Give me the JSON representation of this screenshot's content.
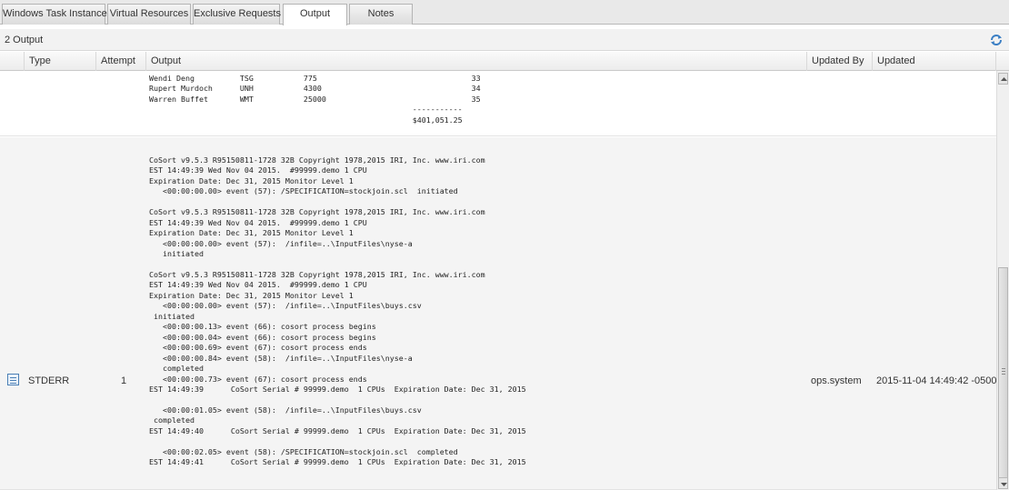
{
  "tabs": [
    {
      "label": "Windows Task Instance"
    },
    {
      "label": "Virtual Resources"
    },
    {
      "label": "Exclusive Requests"
    },
    {
      "label": "Output"
    },
    {
      "label": "Notes"
    }
  ],
  "panel": {
    "title": "2 Output"
  },
  "columns": {
    "type": "Type",
    "attempt": "Attempt",
    "output": "Output",
    "updated_by": "Updated By",
    "updated": "Updated"
  },
  "row1": {
    "output": "Wendi Deng          TSG           775                                  33\nRupert Murdoch      UNH           4300                                 34\nWarren Buffet       WMT           25000                                35\n                                                          -----------\n                                                          $401,051.25"
  },
  "row2": {
    "type": "STDERR",
    "attempt": "1",
    "updated_by": "ops.system",
    "updated": "2015-11-04 14:49:42 -0500",
    "output": "CoSort v9.5.3 R95150811-1728 32B Copyright 1978,2015 IRI, Inc. www.iri.com\nEST 14:49:39 Wed Nov 04 2015.  #99999.demo 1 CPU\nExpiration Date: Dec 31, 2015 Monitor Level 1\n   <00:00:00.00> event (57): /SPECIFICATION=stockjoin.scl  initiated\n\nCoSort v9.5.3 R95150811-1728 32B Copyright 1978,2015 IRI, Inc. www.iri.com\nEST 14:49:39 Wed Nov 04 2015.  #99999.demo 1 CPU\nExpiration Date: Dec 31, 2015 Monitor Level 1\n   <00:00:00.00> event (57):  /infile=..\\InputFiles\\nyse-a\n   initiated\n\nCoSort v9.5.3 R95150811-1728 32B Copyright 1978,2015 IRI, Inc. www.iri.com\nEST 14:49:39 Wed Nov 04 2015.  #99999.demo 1 CPU\nExpiration Date: Dec 31, 2015 Monitor Level 1\n   <00:00:00.00> event (57):  /infile=..\\InputFiles\\buys.csv\n initiated\n   <00:00:00.13> event (66): cosort process begins\n   <00:00:00.04> event (66): cosort process begins\n   <00:00:00.69> event (67): cosort process ends\n   <00:00:00.84> event (58):  /infile=..\\InputFiles\\nyse-a\n   completed\n   <00:00:00.73> event (67): cosort process ends\nEST 14:49:39      CoSort Serial # 99999.demo  1 CPUs  Expiration Date: Dec 31, 2015\n\n   <00:00:01.05> event (58):  /infile=..\\InputFiles\\buys.csv\n completed\nEST 14:49:40      CoSort Serial # 99999.demo  1 CPUs  Expiration Date: Dec 31, 2015\n\n   <00:00:02.05> event (58): /SPECIFICATION=stockjoin.scl  completed\nEST 14:49:41      CoSort Serial # 99999.demo  1 CPUs  Expiration Date: Dec 31, 2015"
  },
  "icons": {
    "refresh": "refresh-icon",
    "row_type": "document-icon"
  },
  "colors": {
    "refresh_blue": "#3b7fc4",
    "tab_border": "#b4b4b4"
  }
}
